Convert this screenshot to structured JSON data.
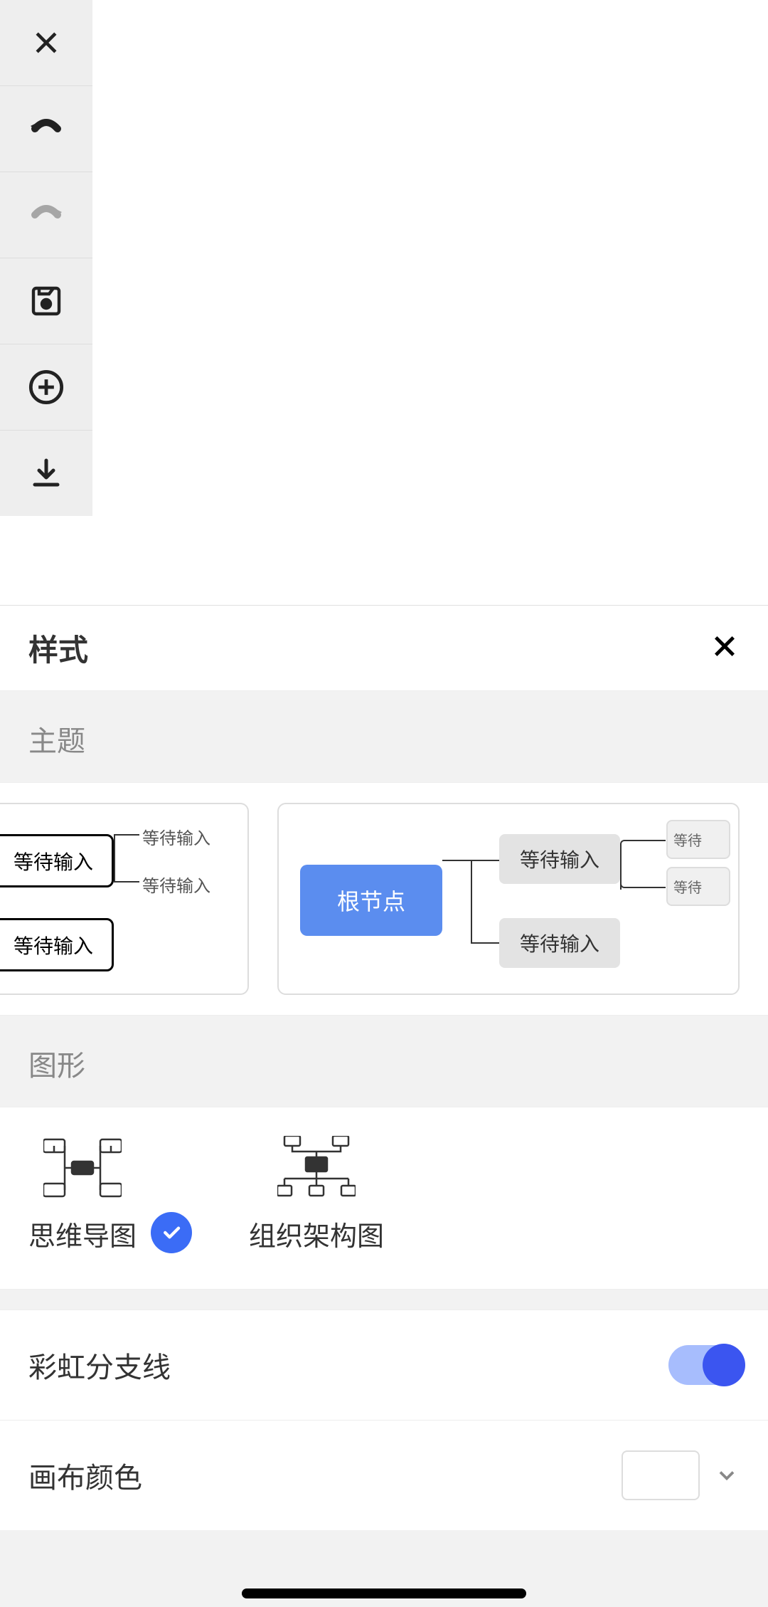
{
  "toolbar": {
    "close": "close",
    "undo": "undo",
    "redo": "redo",
    "save": "save",
    "add": "add",
    "download": "download"
  },
  "panel": {
    "title": "样式",
    "sections": {
      "theme": "主题",
      "shape": "图形"
    },
    "themes": {
      "t1_node": "等待输入",
      "t1_node2": "等待输入",
      "t1_leaf1": "等待输入",
      "t1_leaf2": "等待输入",
      "t2_root": "根节点",
      "t2_node1": "等待输入",
      "t2_node2": "等待输入",
      "t2_leaf_partial": "等待"
    },
    "shapes": {
      "mindmap": "思维导图",
      "orgchart": "组织架构图",
      "selected": "mindmap"
    },
    "settings": {
      "rainbow": {
        "label": "彩虹分支线",
        "value": true
      },
      "canvas_color": {
        "label": "画布颜色",
        "value": "#ffffff"
      }
    }
  }
}
